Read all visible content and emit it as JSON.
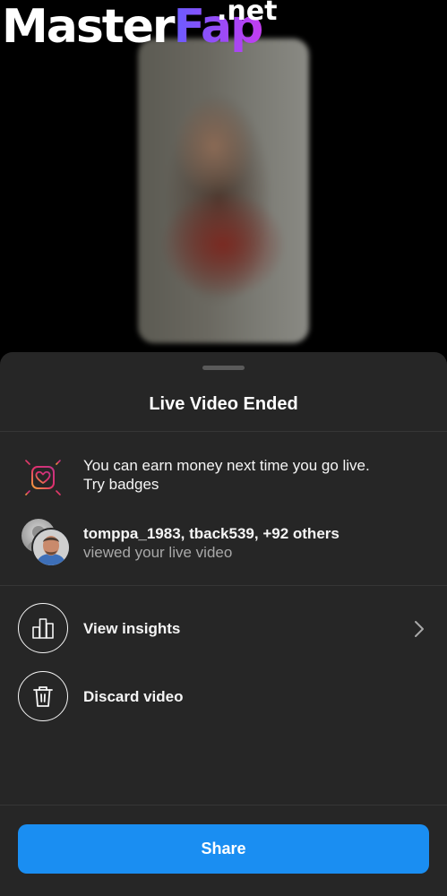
{
  "watermark": {
    "part_a": "Master",
    "part_b": "Fap",
    "suffix": ".net",
    "color_a": "#ffffff",
    "gradient": [
      "#6a5cff",
      "#c23df0"
    ]
  },
  "sheet": {
    "title": "Live Video Ended",
    "badges_row": {
      "icon": "heart-badge-icon",
      "line1": "You can earn money next time you go live.",
      "line2": "Try badges"
    },
    "viewers_row": {
      "icon": "viewer-avatars",
      "names": "tomppa_1983, tback539, +92 others",
      "subtitle": "viewed your live video"
    },
    "actions": [
      {
        "icon": "bar-chart-icon",
        "label": "View insights",
        "trailing_icon": "chevron-right-icon"
      },
      {
        "icon": "trash-icon",
        "label": "Discard video"
      }
    ],
    "share_button": "Share"
  },
  "colors": {
    "background": "#000000",
    "sheet": "#262626",
    "accent": "#1a8ef2",
    "secondary_text": "#a8a8a8",
    "badge_gradient": [
      "#f2a33a",
      "#e1306c",
      "#c13584"
    ]
  }
}
